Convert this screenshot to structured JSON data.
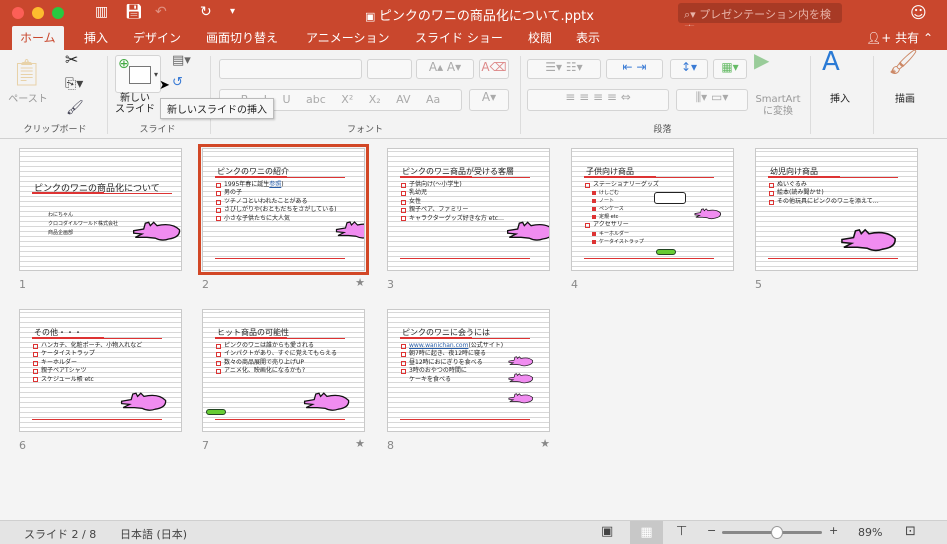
{
  "window": {
    "title": "ピンクのワニの商品化について.pptx",
    "search_placeholder": "プレゼンテーション内を検索"
  },
  "tabs": [
    "ホーム",
    "挿入",
    "デザイン",
    "画面切り替え",
    "アニメーション",
    "スライド ショー",
    "校閲",
    "表示"
  ],
  "share_label": "共有",
  "ribbon": {
    "paste": "ペースト",
    "clipboard": "クリップボード",
    "new_slide_1": "新しい",
    "new_slide_2": "スライド",
    "slide_group": "スライド",
    "font_group": "フォント",
    "paragraph_group": "段落",
    "smartart_1": "SmartArt",
    "smartart_2": "に変換",
    "insert": "挿入",
    "draw": "描画",
    "tooltip": "新しいスライドの挿入"
  },
  "slides": [
    {
      "num": "1",
      "title": "ピンクのワニの商品化について",
      "subtitle": [
        "わにちゃん",
        "クロコダイルワールド株式会社",
        "商品企画部"
      ],
      "bullets": [],
      "star": false
    },
    {
      "num": "2",
      "title": "ピンクのワニの紹介",
      "bullets": [
        {
          "t": "1995年春に誕生",
          "link": "参照",
          "after": ")"
        },
        {
          "t": "男の子"
        },
        {
          "t": "ツチノコといわれたことがある"
        },
        {
          "t": "さびしがりや(おともだちをさがしている)"
        },
        {
          "t": "小さな子供たちに大人気"
        }
      ],
      "star": true
    },
    {
      "num": "3",
      "title": "ピンクのワニ商品が受ける客層",
      "bullets": [
        {
          "t": "子供向け(～小学生)"
        },
        {
          "t": "乳幼児"
        },
        {
          "t": "女性"
        },
        {
          "t": "親子ペア、ファミリー"
        },
        {
          "t": "キャラクターグッズ好きな方 etc…"
        }
      ],
      "star": false
    },
    {
      "num": "4",
      "title": "子供向け商品",
      "bullets": [
        {
          "t": "ステーショナリーグッズ"
        },
        {
          "t": "けしごむ",
          "l": 2
        },
        {
          "t": "ノート",
          "l": 2
        },
        {
          "t": "ペンケース",
          "l": 2
        },
        {
          "t": "定規 etc",
          "l": 2
        },
        {
          "t": "アクセサリー"
        },
        {
          "t": "キーホルダー",
          "l": 2
        },
        {
          "t": "ケータイストラップ",
          "l": 2
        }
      ],
      "star": false
    },
    {
      "num": "5",
      "title": "幼児向け商品",
      "bullets": [
        {
          "t": "ぬいぐるみ"
        },
        {
          "t": "絵本(読み聞かせ)"
        },
        {
          "t": "その他玩具にピンクのワニを添えて…"
        }
      ],
      "star": false
    },
    {
      "num": "6",
      "title": "その他・・・",
      "bullets": [
        {
          "t": "ハンカチ、化粧ポーチ、小物入れなど"
        },
        {
          "t": "ケータイストラップ"
        },
        {
          "t": "キーホルダー"
        },
        {
          "t": "親子ペアTシャツ"
        },
        {
          "t": "スケジュール帳 etc"
        }
      ],
      "star": false
    },
    {
      "num": "7",
      "title": "ヒット商品の可能性",
      "bullets": [
        {
          "t": "ピンクのワニは誰からも愛される"
        },
        {
          "t": "インパクトがあり、すぐに覚えてもらえる"
        },
        {
          "t": "数々の商品展開で売り上げUP"
        },
        {
          "t": "アニメ化、映画化になるかも?"
        }
      ],
      "star": true
    },
    {
      "num": "8",
      "title": "ピンクのワニに会うには",
      "bullets": [
        {
          "t": "",
          "link": "www.wanichan.com",
          "after": " (公式サイト)"
        },
        {
          "t": "朝7時に起き、夜12時に寝る"
        },
        {
          "t": "昼12時におにぎりを食べる"
        },
        {
          "t": "3時のおやつの時間に"
        },
        {
          "t": "ケーキを食べる",
          "cont": true
        }
      ],
      "star": true
    }
  ],
  "status": {
    "slide": "スライド 2 / 8",
    "language": "日本語 (日本)",
    "zoom": "89%",
    "zoom_level": 0.55
  },
  "colors": {
    "accent": "#c9472d",
    "croc": "#f08cf0"
  }
}
